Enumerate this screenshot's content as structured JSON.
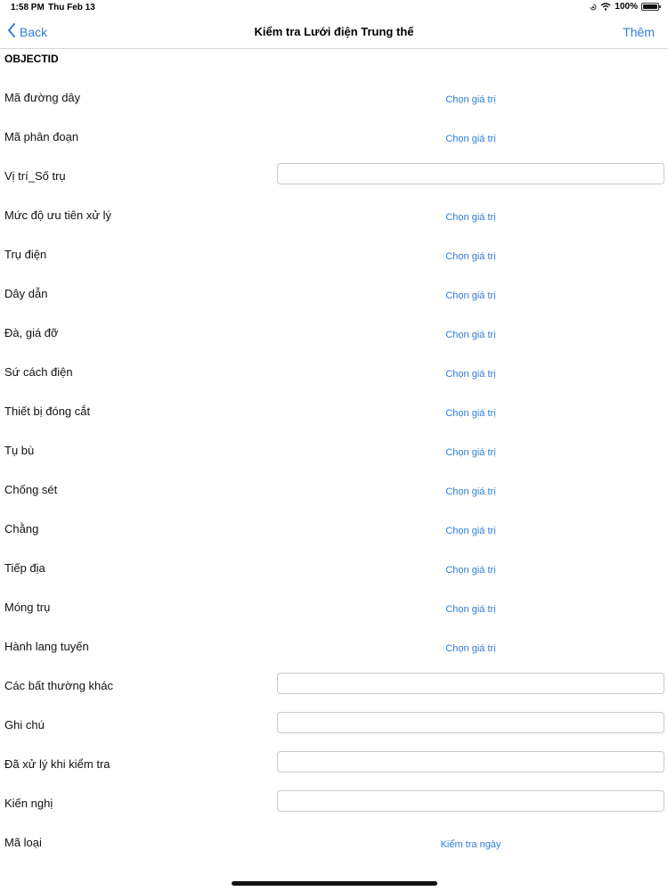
{
  "status": {
    "time": "1:58 PM",
    "date": "Thu Feb 13",
    "battery": "100%"
  },
  "nav": {
    "back_label": "Back",
    "title": "Kiểm tra Lưới điện Trung thế",
    "add_label": "Thêm"
  },
  "form": {
    "objectid_label": "OBJECTID",
    "rows": [
      {
        "label": "Mã đường dây",
        "type": "picker",
        "value": "Chọn giá trị"
      },
      {
        "label": "Mã phân đoạn",
        "type": "picker",
        "value": "Chọn giá trị"
      },
      {
        "label": "Vị trí_Số trụ",
        "type": "input",
        "value": ""
      },
      {
        "label": "Mức độ ưu tiên xử lý",
        "type": "picker",
        "value": "Chọn giá trị"
      },
      {
        "label": "Trụ điện",
        "type": "picker",
        "value": "Chọn giá trị"
      },
      {
        "label": "Dây dẫn",
        "type": "picker",
        "value": "Chọn giá trị"
      },
      {
        "label": "Đà, giá đỡ",
        "type": "picker",
        "value": "Chọn giá trị"
      },
      {
        "label": "Sứ cách điện",
        "type": "picker",
        "value": "Chọn giá trị"
      },
      {
        "label": "Thiết bị đóng cắt",
        "type": "picker",
        "value": "Chọn giá trị"
      },
      {
        "label": "Tụ bù",
        "type": "picker",
        "value": "Chọn giá trị"
      },
      {
        "label": "Chống sét",
        "type": "picker",
        "value": "Chọn giá trị"
      },
      {
        "label": "Chằng",
        "type": "picker",
        "value": "Chọn giá trị"
      },
      {
        "label": "Tiếp địa",
        "type": "picker",
        "value": "Chọn giá trị"
      },
      {
        "label": "Móng trụ",
        "type": "picker",
        "value": "Chọn giá trị"
      },
      {
        "label": "Hành lang tuyến",
        "type": "picker",
        "value": "Chọn giá trị"
      },
      {
        "label": "Các bất thường khác",
        "type": "input",
        "value": ""
      },
      {
        "label": "Ghi chú",
        "type": "input",
        "value": ""
      },
      {
        "label": "Đã xử lý khi kiểm tra",
        "type": "input",
        "value": ""
      },
      {
        "label": "Kiến nghị",
        "type": "input",
        "value": ""
      },
      {
        "label": "Mã loại",
        "type": "picker",
        "value": "Kiểm tra ngày"
      }
    ]
  },
  "colors": {
    "accent": "#2f7ed8",
    "separator": "#d8d8d8",
    "input_border": "#c9c9c9"
  }
}
